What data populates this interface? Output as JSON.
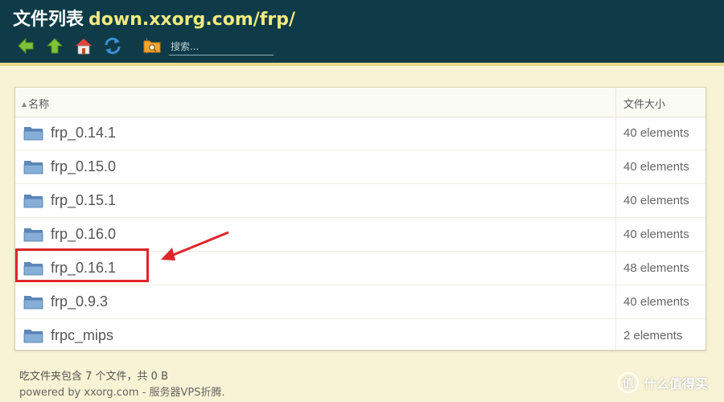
{
  "header": {
    "title": "文件列表",
    "path": "down.xxorg.com/frp/",
    "search_placeholder": "搜索..."
  },
  "toolbar": {
    "icons": [
      "back-arrow-icon",
      "up-arrow-icon",
      "home-icon",
      "refresh-icon",
      "folder-search-icon"
    ],
    "colors": {
      "green": "#7fc23a",
      "red": "#e0443a",
      "blue": "#3d8fd6",
      "orange": "#f3a531"
    }
  },
  "table": {
    "columns": {
      "name": "名称",
      "size": "文件大小"
    },
    "rows": [
      {
        "name": "frp_0.14.1",
        "size": "40 elements"
      },
      {
        "name": "frp_0.15.0",
        "size": "40 elements"
      },
      {
        "name": "frp_0.15.1",
        "size": "40 elements"
      },
      {
        "name": "frp_0.16.0",
        "size": "40 elements"
      },
      {
        "name": "frp_0.16.1",
        "size": "48 elements"
      },
      {
        "name": "frp_0.9.3",
        "size": "40 elements"
      },
      {
        "name": "frpc_mips",
        "size": "2 elements"
      }
    ]
  },
  "annotation": {
    "highlight_color": "#e0252b"
  },
  "footer": {
    "summary": "吃文件夹包含 7 个文件，共 0 B",
    "powered": "powered by xxorg.com - 服务器VPS折腾."
  },
  "watermark": {
    "text": "什么值得买"
  },
  "colors": {
    "header_bg": "#0e3b47",
    "path_color": "#f0e97f",
    "page_bg": "#f8f3d4"
  }
}
